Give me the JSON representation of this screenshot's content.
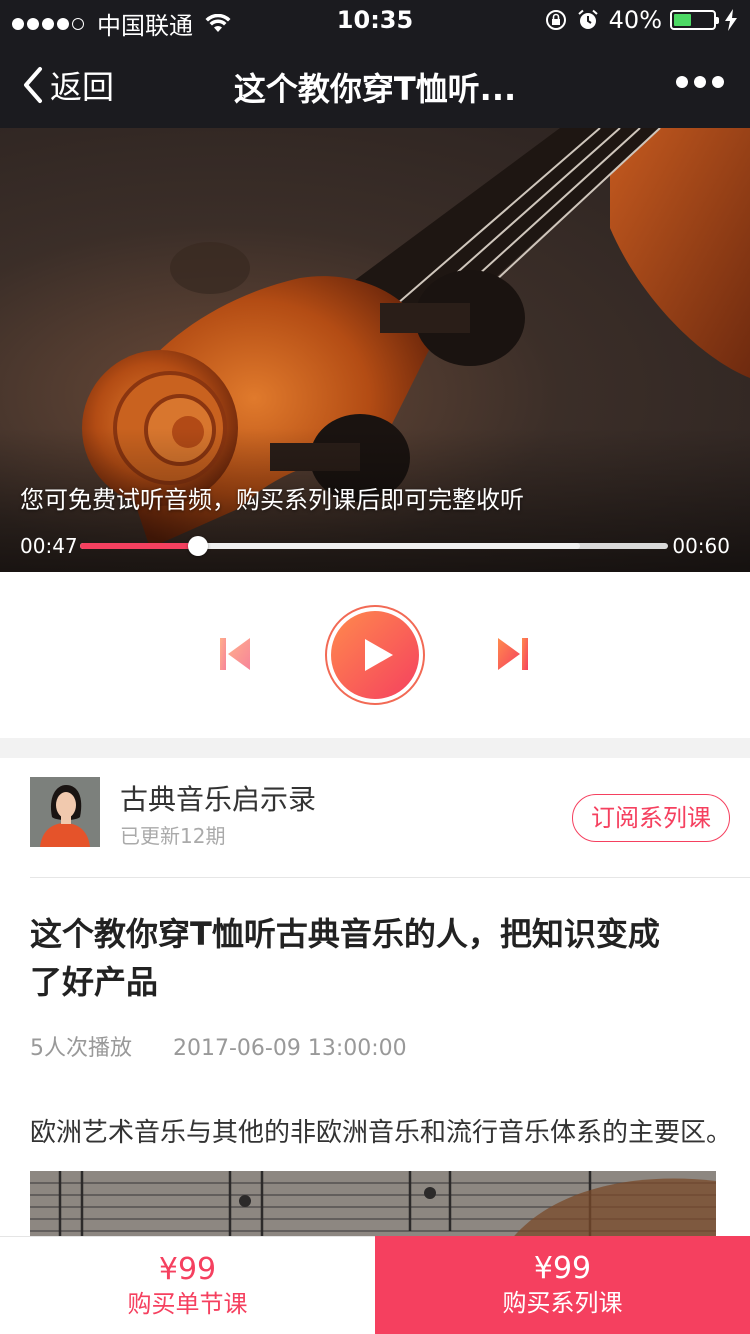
{
  "status_bar": {
    "carrier": "中国联通",
    "time": "10:35",
    "battery_percent": "40%",
    "battery_level": 0.4,
    "signal_bars_filled": 4,
    "icons": [
      "signal-dots-icon",
      "wifi-icon",
      "rotation-lock-icon",
      "alarm-icon",
      "battery-icon",
      "charging-icon"
    ]
  },
  "nav": {
    "back_label": "返回",
    "title": "这个教你穿T恤听...",
    "more_icon": "more-dots-icon"
  },
  "player": {
    "notice": "您可免费试听音频，购买系列课后即可完整收听",
    "current_time": "00:47",
    "total_time": "00:60",
    "progress": 0.2,
    "buffered": 0.85,
    "accent_color": "#f5405f",
    "icons": [
      "previous-track-icon",
      "play-icon",
      "next-track-icon"
    ]
  },
  "series": {
    "name": "古典音乐启示录",
    "updated": "已更新12期",
    "subscribe_label": "订阅系列课"
  },
  "article": {
    "title": "这个教你穿T恤听古典音乐的人，把知识变成了好产品",
    "plays": "5人次播放",
    "datetime": "2017-06-09 13:00:00",
    "excerpt": "欧洲艺术音乐与其他的非欧洲音乐和流行音乐体系的主要区。"
  },
  "bottom_bar": {
    "single": {
      "price": "¥99",
      "label": "购买单节课"
    },
    "series": {
      "price": "¥99",
      "label": "购买系列课"
    }
  }
}
